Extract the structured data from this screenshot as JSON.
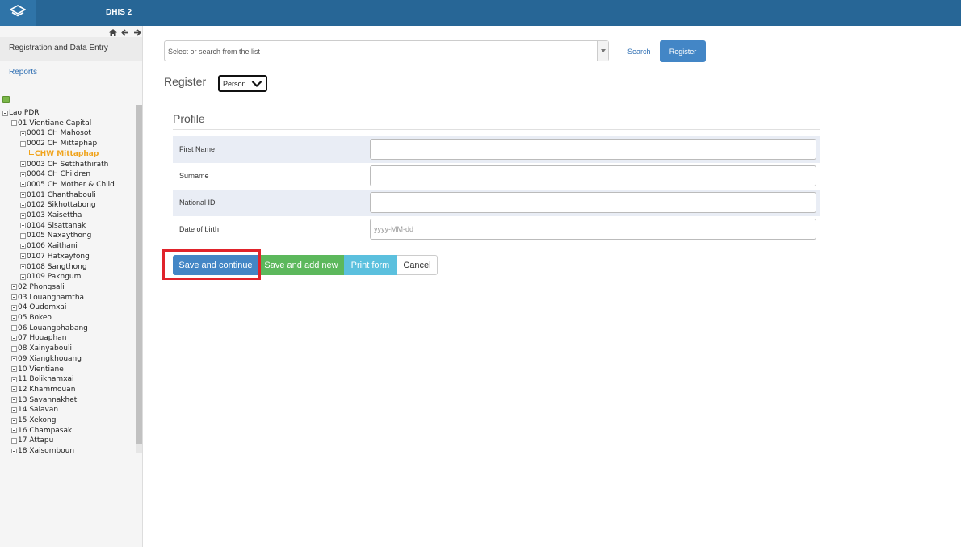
{
  "header": {
    "app_title": "DHIS 2"
  },
  "sidebar": {
    "menu": [
      "Registration and Data Entry",
      "Reports"
    ],
    "tree": [
      {
        "label": "Lao PDR",
        "toggle": "minus",
        "indent": 0
      },
      {
        "label": "01 Vientiane Capital",
        "toggle": "minus",
        "indent": 1
      },
      {
        "label": "0001 CH Mahosot",
        "toggle": "plus",
        "indent": 2
      },
      {
        "label": "0002 CH Mittaphap",
        "toggle": "minus",
        "indent": 2
      },
      {
        "label": "CHW Mittaphap",
        "toggle": "selected",
        "indent": 3
      },
      {
        "label": "0003 CH Setthathirath",
        "toggle": "plus",
        "indent": 2
      },
      {
        "label": "0004 CH Children",
        "toggle": "plus",
        "indent": 2
      },
      {
        "label": "0005 CH Mother & Child",
        "toggle": "minus",
        "indent": 2
      },
      {
        "label": "0101 Chanthabouli",
        "toggle": "plus",
        "indent": 2
      },
      {
        "label": "0102 Sikhottabong",
        "toggle": "plus",
        "indent": 2
      },
      {
        "label": "0103 Xaisettha",
        "toggle": "plus",
        "indent": 2
      },
      {
        "label": "0104 Sisattanak",
        "toggle": "minus",
        "indent": 2
      },
      {
        "label": "0105 Naxaythong",
        "toggle": "plus",
        "indent": 2
      },
      {
        "label": "0106 Xaithani",
        "toggle": "plus",
        "indent": 2
      },
      {
        "label": "0107 Hatxayfong",
        "toggle": "plus",
        "indent": 2
      },
      {
        "label": "0108 Sangthong",
        "toggle": "minus",
        "indent": 2
      },
      {
        "label": "0109 Pakngum",
        "toggle": "plus",
        "indent": 2
      },
      {
        "label": "02 Phongsali",
        "toggle": "minus",
        "indent": 1
      },
      {
        "label": "03 Louangnamtha",
        "toggle": "minus",
        "indent": 1
      },
      {
        "label": "04 Oudomxai",
        "toggle": "minus",
        "indent": 1
      },
      {
        "label": "05 Bokeo",
        "toggle": "minus",
        "indent": 1
      },
      {
        "label": "06 Louangphabang",
        "toggle": "minus",
        "indent": 1
      },
      {
        "label": "07 Houaphan",
        "toggle": "minus",
        "indent": 1
      },
      {
        "label": "08 Xainyabouli",
        "toggle": "minus",
        "indent": 1
      },
      {
        "label": "09 Xiangkhouang",
        "toggle": "minus",
        "indent": 1
      },
      {
        "label": "10 Vientiane",
        "toggle": "minus",
        "indent": 1
      },
      {
        "label": "11 Bolikhamxai",
        "toggle": "minus",
        "indent": 1
      },
      {
        "label": "12 Khammouan",
        "toggle": "minus",
        "indent": 1
      },
      {
        "label": "13 Savannakhet",
        "toggle": "minus",
        "indent": 1
      },
      {
        "label": "14 Salavan",
        "toggle": "minus",
        "indent": 1
      },
      {
        "label": "15 Xekong",
        "toggle": "minus",
        "indent": 1
      },
      {
        "label": "16 Champasak",
        "toggle": "minus",
        "indent": 1
      },
      {
        "label": "17 Attapu",
        "toggle": "minus",
        "indent": 1
      },
      {
        "label": "18 Xaisomboun",
        "toggle": "minus",
        "indent": 1
      }
    ]
  },
  "search": {
    "placeholder": "Select or search from the list",
    "link_label": "Search",
    "register_label": "Register"
  },
  "register": {
    "title": "Register",
    "entity_type": "Person"
  },
  "profile": {
    "title": "Profile",
    "fields": [
      {
        "label": "First Name",
        "value": "",
        "placeholder": ""
      },
      {
        "label": "Surname",
        "value": "",
        "placeholder": ""
      },
      {
        "label": "National ID",
        "value": "",
        "placeholder": ""
      },
      {
        "label": "Date of birth",
        "value": "",
        "placeholder": "yyyy-MM-dd"
      }
    ]
  },
  "actions": {
    "save_continue": "Save and continue",
    "save_new": "Save and add new",
    "print_form": "Print form",
    "cancel": "Cancel"
  },
  "colors": {
    "header": "#276696",
    "primary": "#4386c6",
    "success": "#5cb85c",
    "info": "#5bc0de",
    "highlight": "#e0232b",
    "selected_node": "#f0a31b"
  },
  "icons": [
    "dhis-logo-icon",
    "home-icon",
    "arrow-left-icon",
    "arrow-right-icon",
    "tree-search-icon",
    "chevron-down-icon"
  ]
}
